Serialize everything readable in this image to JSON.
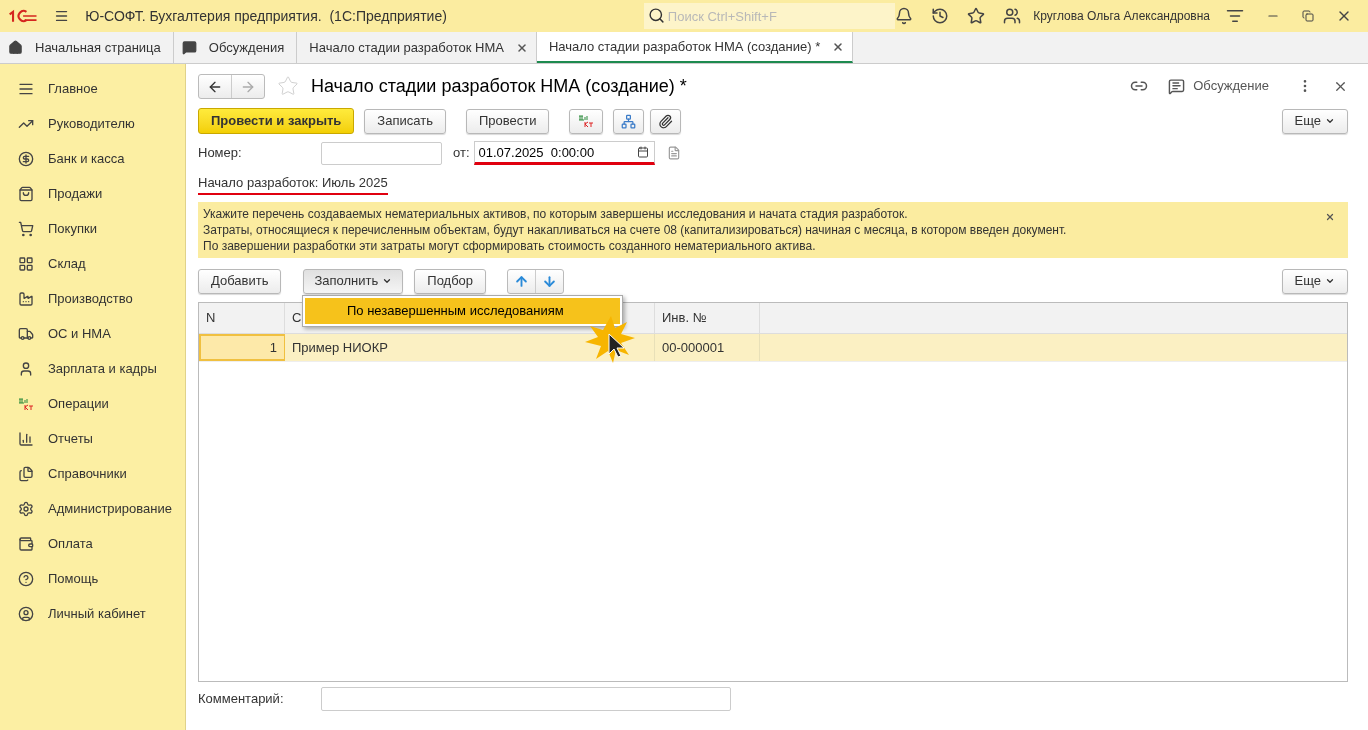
{
  "app_title": "Ю-СОФТ. Бухгалтерия предприятия.  (1С:Предприятие)",
  "search": {
    "placeholder": "Поиск Ctrl+Shift+F"
  },
  "user": "Круглова Ольга Александровна",
  "tabs": [
    {
      "label": "Начальная страница",
      "selected": false,
      "closable": false
    },
    {
      "label": "Обсуждения",
      "selected": false,
      "closable": false
    },
    {
      "label": "Начало стадии разработок НМА",
      "selected": false,
      "closable": true
    },
    {
      "label": "Начало стадии разработок НМА (создание) *",
      "selected": true,
      "closable": true
    }
  ],
  "sidebar": {
    "items": [
      {
        "label": "Главное"
      },
      {
        "label": "Руководителю"
      },
      {
        "label": "Банк и касса"
      },
      {
        "label": "Продажи"
      },
      {
        "label": "Покупки"
      },
      {
        "label": "Склад"
      },
      {
        "label": "Производство"
      },
      {
        "label": "ОС и НМА"
      },
      {
        "label": "Зарплата и кадры"
      },
      {
        "label": "Операции"
      },
      {
        "label": "Отчеты"
      },
      {
        "label": "Справочники"
      },
      {
        "label": "Администрирование"
      },
      {
        "label": "Оплата"
      },
      {
        "label": "Помощь"
      },
      {
        "label": "Личный кабинет"
      }
    ]
  },
  "form": {
    "title": "Начало стадии разработок НМА (создание) *",
    "discussion": "Обсуждение",
    "buttons": [
      {
        "label": "Провести и закрыть",
        "primary": true
      },
      {
        "label": "Записать",
        "primary": false
      },
      {
        "label": "Провести",
        "primary": false
      }
    ],
    "more": "Еще",
    "number": {
      "label": "Номер:"
    },
    "date": {
      "label": "от:",
      "value": "01.07.2025  0:00:00",
      "highlighted": true
    },
    "period": {
      "text": "Начало разработок: Июль 2025",
      "highlighted": true
    },
    "info": [
      "Укажите перечень создаваемых нематериальных активов, по которым завершены исследования и начата стадия разработок.",
      "Затраты, относящиеся к перечисленным объектам, будут накапливаться на счете 08 (капитализироваться) начиная с месяца, в котором введен документ.",
      "По завершении разработки эти затраты могут сформировать стоимость созданного нематериального актива."
    ],
    "table_toolbar": {
      "add": "Добавить",
      "fill": "Заполнить",
      "pick": "Подбор",
      "more": "Еще"
    },
    "fill_menu": {
      "open": true,
      "items": [
        {
          "label": "По незавершенным исследованиям",
          "selected": true
        }
      ]
    },
    "table": {
      "columns": [
        "N",
        "С",
        "Инв. №"
      ],
      "rows": [
        {
          "cells": [
            "1",
            "Пример НИОКР",
            "00-000001"
          ],
          "selected": true
        }
      ]
    },
    "comment": {
      "label": "Комментарий:"
    }
  }
}
